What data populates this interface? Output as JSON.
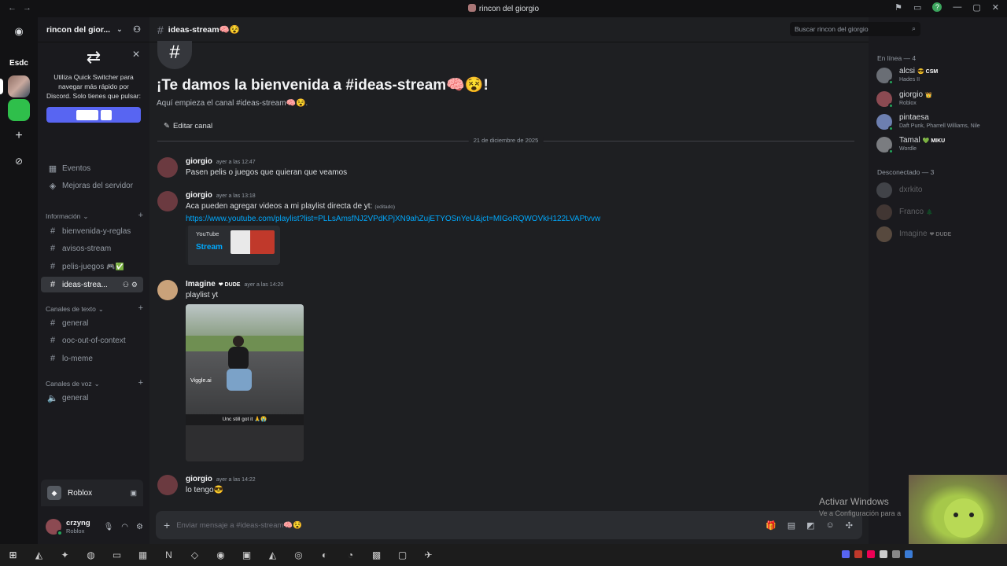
{
  "window": {
    "title": "rincon del giorgio"
  },
  "guilds": {
    "esdc_label": "Esdc"
  },
  "server": {
    "name": "rincon del gior..."
  },
  "quick_switcher": {
    "text": "Utiliza Quick Switcher para navegar más rápido por Discord. Solo tienes que pulsar:",
    "close": "✕"
  },
  "sidebar": {
    "events": "Eventos",
    "boosts": "Mejoras del servidor",
    "cat_info": "Información",
    "info_channels": [
      "bienvenida-y-reglas",
      "avisos-stream",
      "pelis-juegos",
      "ideas-strea..."
    ],
    "cat_text": "Canales de texto",
    "text_channels": [
      "general",
      "ooc-out-of-context",
      "lo-meme"
    ],
    "cat_voice": "Canales de voz",
    "voice_channels": [
      "general"
    ]
  },
  "game_panel": {
    "name": "Roblox"
  },
  "user_panel": {
    "username": "crzyng",
    "activity": "Roblox"
  },
  "channel_header": {
    "name": "ideas-stream🧠😵"
  },
  "search": {
    "placeholder": "Buscar rincon del giorgio"
  },
  "welcome": {
    "title": "¡Te damos la bienvenida a #ideas-stream🧠😵!",
    "subtitle": "Aquí empieza el canal #ideas-stream🧠😵.",
    "edit_button": "Editar canal"
  },
  "date_divider": "21 de diciembre de 2025",
  "messages": [
    {
      "author": "giorgio",
      "time": "ayer a las 12:47",
      "text": "Pasen pelis o juegos que quieran que veamos"
    },
    {
      "author": "giorgio",
      "time": "ayer a las 13:18",
      "text": "Aca pueden agregar videos a mi playlist directa de yt:",
      "edited": "(editado)",
      "link": "https://www.youtube.com/playlist?list=PLLsAmsfNJ2VPdKPjXN9ahZujETYOSnYeU&jct=MIGoRQWOVkH122LVAPtvvw",
      "embed_provider": "YouTube",
      "embed_title": "Stream"
    },
    {
      "author": "Imagine",
      "tag": "❤ DUDE",
      "time": "ayer a las 14:20",
      "text": "playlist yt",
      "video_watermark": "Viggle.ai",
      "video_caption": "Unc still got it 🙏😭"
    },
    {
      "author": "giorgio",
      "time": "ayer a las 14:22",
      "text": "lo tengo😎"
    }
  ],
  "composer": {
    "placeholder": "Enviar mensaje a #ideas-stream🧠😵"
  },
  "members": {
    "online_header": "En línea — 4",
    "online": [
      {
        "name": "alcsi",
        "tag": "😎 CSM",
        "activity": "Hades II"
      },
      {
        "name": "giorgio",
        "tag": "👑",
        "activity": "Roblox"
      },
      {
        "name": "pintaesa",
        "tag": "",
        "activity": "Daft Punk, Pharrell Williams, Nile"
      },
      {
        "name": "Tamal",
        "tag": "💚 MIKU",
        "activity": "Wordle"
      }
    ],
    "offline_header": "Desconectado — 3",
    "offline": [
      {
        "name": "dxrkito",
        "tag": ""
      },
      {
        "name": "Franco",
        "tag": "🌲"
      },
      {
        "name": "Imagine",
        "tag": "❤ DUDE"
      }
    ]
  },
  "watermark": {
    "line1": "Activar Windows",
    "line2": "Ve a Configuración para a"
  },
  "colors": {
    "accent": "#5865f2",
    "link": "#00a8fc",
    "online": "#23a55a"
  }
}
